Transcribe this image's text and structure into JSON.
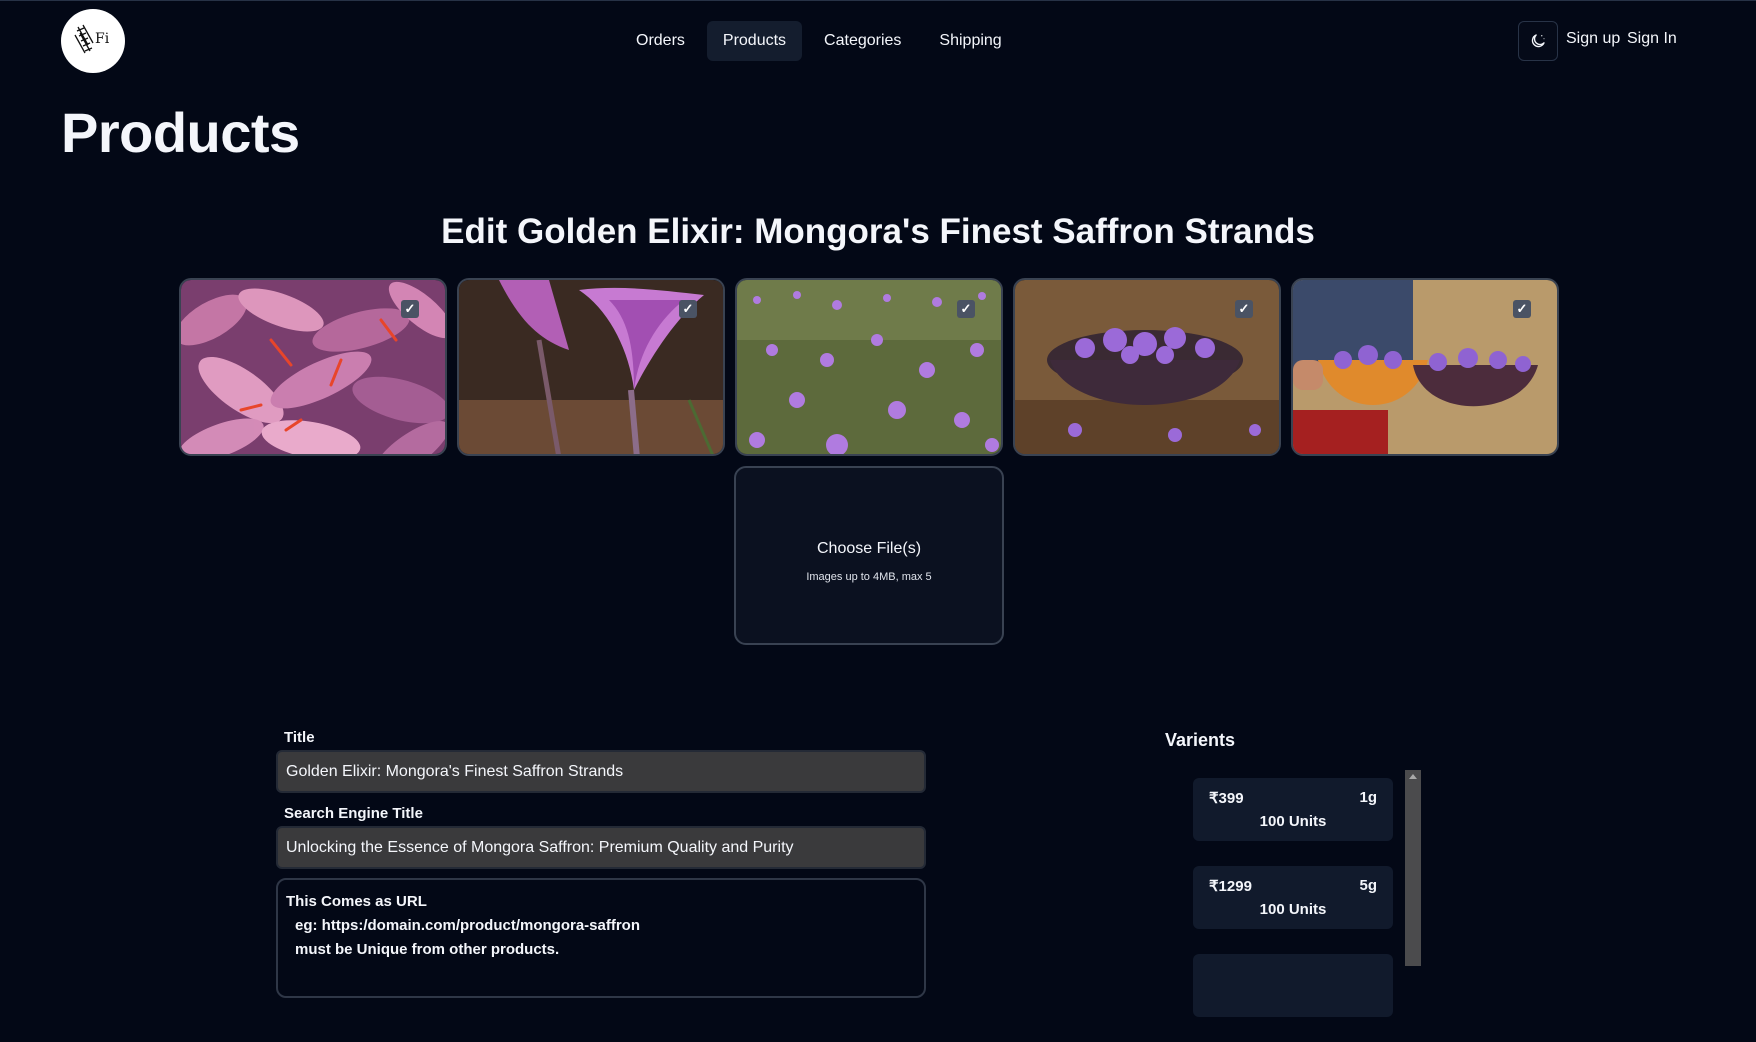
{
  "brand": {
    "logo_text": "Fi"
  },
  "nav": {
    "items": [
      {
        "label": "Orders"
      },
      {
        "label": "Products"
      },
      {
        "label": "Categories"
      },
      {
        "label": "Shipping"
      }
    ],
    "active": "Products"
  },
  "auth": {
    "signup": "Sign up",
    "signin": "Sign In"
  },
  "theme_icon": "moon-icon",
  "page": {
    "title": "Products"
  },
  "edit": {
    "heading": "Edit Golden Elixir: Mongora's Finest Saffron Strands"
  },
  "images": [
    {
      "name": "saffron-flowers-closeup",
      "selected": true
    },
    {
      "name": "single-crocus-bloom",
      "selected": true
    },
    {
      "name": "crocus-field",
      "selected": true
    },
    {
      "name": "basket-of-crocus",
      "selected": true
    },
    {
      "name": "hands-holding-baskets",
      "selected": true
    }
  ],
  "upload": {
    "label": "Choose File(s)",
    "hint": "Images up to 4MB, max 5"
  },
  "form": {
    "title_label": "Title",
    "title_value": "Golden Elixir: Mongora's Finest Saffron Strands",
    "seo_label": "Search Engine Title",
    "seo_value": "Unlocking the Essence of Mongora Saffron: Premium Quality and Purity",
    "url_help": {
      "line1": "This Comes as URL",
      "line2": "eg: https:/domain.com/product/mongora-saffron",
      "line3": "must be Unique from other products."
    }
  },
  "variants": {
    "title": "Varients",
    "items": [
      {
        "price": "₹399",
        "weight": "1g",
        "units": "100 Units"
      },
      {
        "price": "₹1299",
        "weight": "5g",
        "units": "100 Units"
      }
    ]
  }
}
